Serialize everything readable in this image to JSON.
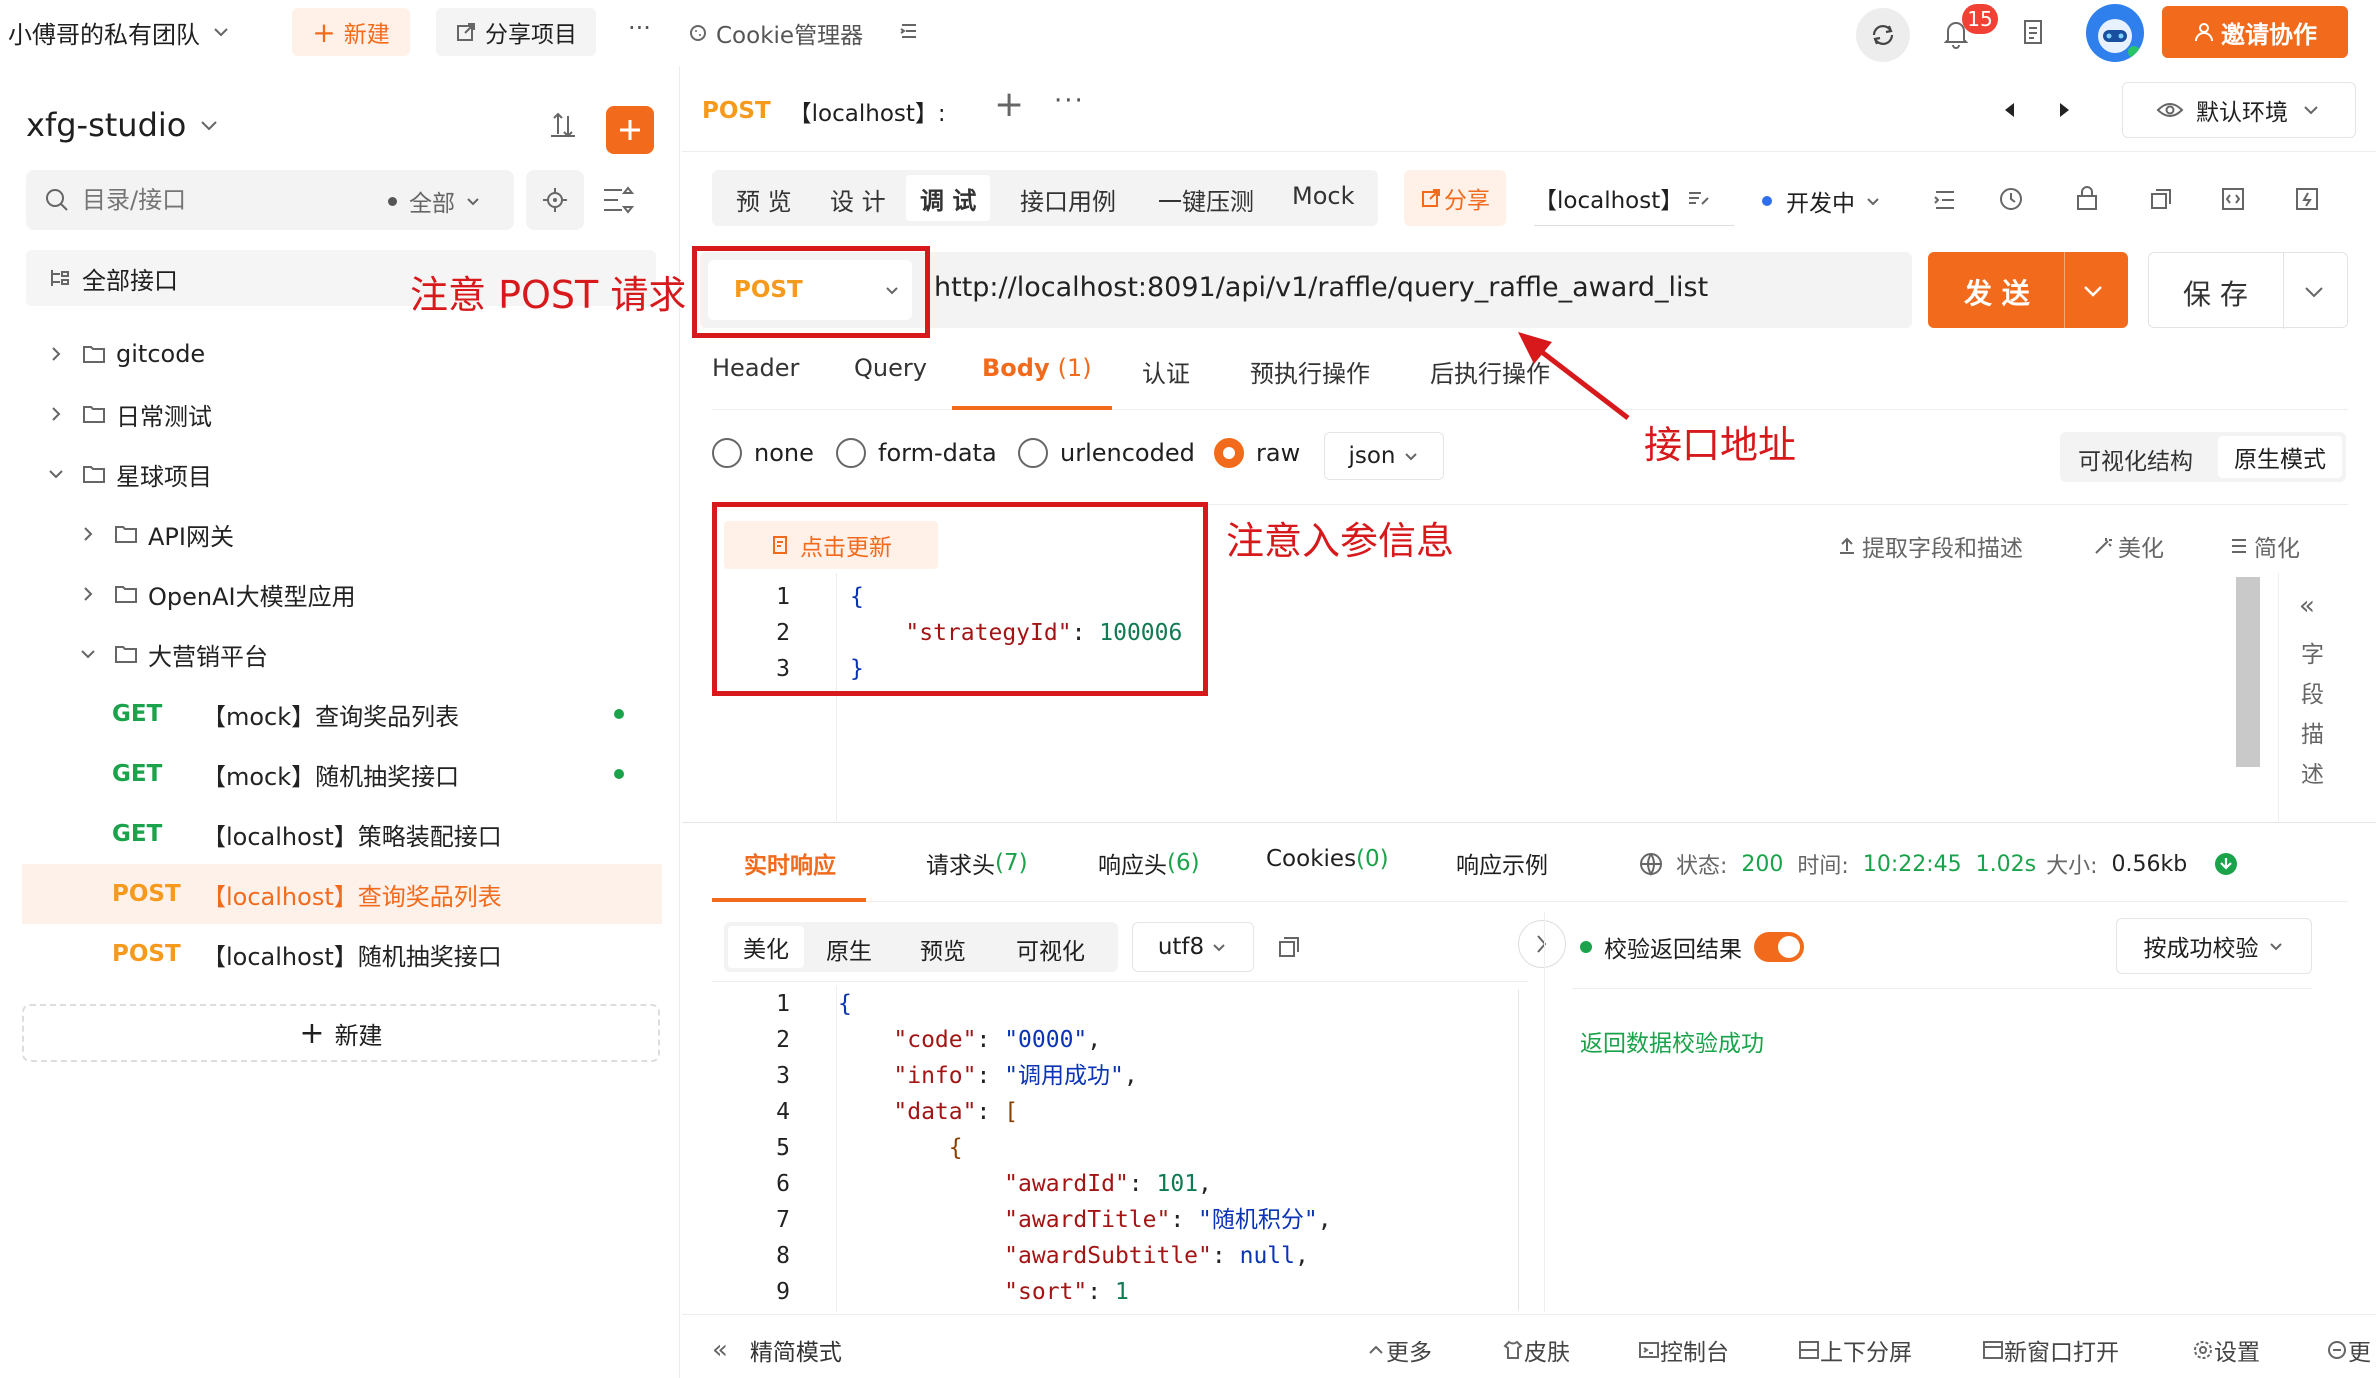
{
  "topbar": {
    "team_name": "小傅哥的私有团队",
    "new_label": "新建",
    "share_project_label": "分享项目",
    "more_label": "···",
    "cookie_label": "Cookie管理器",
    "notif_count": "15",
    "invite_label": "邀请协作"
  },
  "sidebar": {
    "project_name": "xfg-studio",
    "search_placeholder": "目录/接口",
    "filter_label": "全部",
    "all_apis_label": "全部接口",
    "tree": [
      {
        "label": "gitcode"
      },
      {
        "label": "日常测试"
      },
      {
        "label": "星球项目"
      },
      {
        "label": "API网关"
      },
      {
        "label": "OpenAI大模型应用"
      },
      {
        "label": "大营销平台"
      }
    ],
    "apis": [
      {
        "method": "GET",
        "name": "【mock】查询奖品列表"
      },
      {
        "method": "GET",
        "name": "【mock】随机抽奖接口"
      },
      {
        "method": "GET",
        "name": "【localhost】策略装配接口"
      },
      {
        "method": "POST",
        "name": "【localhost】查询奖品列表"
      },
      {
        "method": "POST",
        "name": "【localhost】随机抽奖接口"
      }
    ],
    "new_label": "新建"
  },
  "tabbar": {
    "method": "POST",
    "title": "【localhost】:",
    "env_label": "默认环境"
  },
  "mode_tabs": [
    "预 览",
    "设 计",
    "调 试",
    "接口用例",
    "一键压测",
    "Mock"
  ],
  "share_label": "分享",
  "api_title": "【localhost】",
  "status_label": "开发中",
  "request": {
    "method": "POST",
    "url": "http://localhost:8091/api/v1/raffle/query_raffle_award_list",
    "send_label": "发 送",
    "save_label": "保 存"
  },
  "param_tabs": [
    "Header",
    "Query",
    "Body",
    "认证",
    "预执行操作",
    "后执行操作"
  ],
  "body_count": "(1)",
  "body_types": [
    "none",
    "form-data",
    "urlencoded",
    "raw"
  ],
  "body_format": "json",
  "view_modes": [
    "可视化结构",
    "原生模式"
  ],
  "editor": {
    "update_label": "点击更新",
    "extract_label": "提取字段和描述",
    "beautify_label": "美化",
    "simplify_label": "简化",
    "field_desc_label": [
      "字",
      "段",
      "描",
      "述"
    ],
    "lines": [
      "1",
      "2",
      "3"
    ]
  },
  "annotations": {
    "post_note": "注意 POST 请求",
    "url_note": "接口地址",
    "param_note": "注意入参信息"
  },
  "response": {
    "tabs": [
      "实时响应",
      "请求头",
      "响应头",
      "Cookies",
      "响应示例"
    ],
    "tab_counts": [
      "",
      "(7)",
      "(6)",
      "(0)",
      ""
    ],
    "status_label": "状态:",
    "status_code": "200",
    "time_label": "时间:",
    "time_value": "10:22:45",
    "duration": "1.02s",
    "size_label": "大小:",
    "size_value": "0.56kb",
    "view_tabs": [
      "美化",
      "原生",
      "预览",
      "可视化"
    ],
    "encoding": "utf8",
    "validate_label": "校验返回结果",
    "validate_mode": "按成功校验",
    "validate_result": "返回数据校验成功",
    "lines": [
      "1",
      "2",
      "3",
      "4",
      "5",
      "6",
      "7",
      "8",
      "9"
    ]
  },
  "footer": {
    "simple_mode": "精简模式",
    "items": [
      "更多",
      "皮肤",
      "控制台",
      "上下分屏",
      "新窗口打开",
      "设置",
      "更"
    ]
  },
  "colors": {
    "brand_orange": "#f26b1d",
    "annotation_red": "#d7191c",
    "get_green": "#1aa34a",
    "post_orange": "#f59a1d"
  }
}
